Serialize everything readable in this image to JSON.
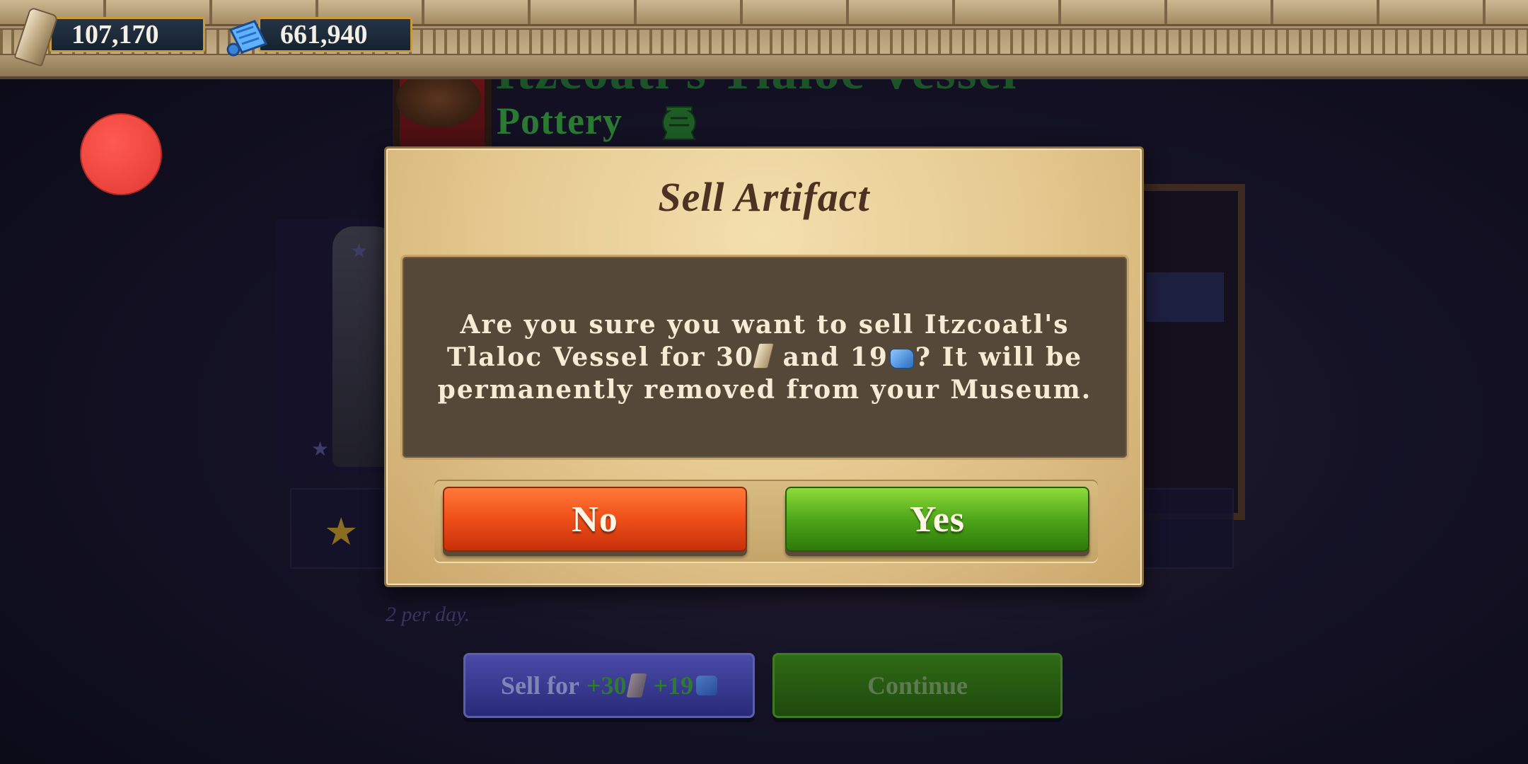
{
  "currency": {
    "artifacts": "107,170",
    "scrolls": "661,940"
  },
  "background": {
    "artifact_title": "Itzcoatl's Tlaloc Vessel",
    "category": "Pottery",
    "per_day_text": "2 per day.",
    "sell_button": {
      "label": "Sell for",
      "artifact_amount": "+30",
      "scroll_amount": "+19"
    },
    "continue_button": "Continue"
  },
  "dialog": {
    "title": "Sell Artifact",
    "message_part1": "Are you sure you want to sell Itzcoatl's Tlaloc Vessel for 30",
    "message_part2": " and 19",
    "message_part3": "? It will be permanently removed from your Museum.",
    "no_label": "No",
    "yes_label": "Yes"
  },
  "colors": {
    "no_button": "#f2521a",
    "yes_button": "#4ea61a",
    "dialog_bg": "#e3c68c",
    "message_box": "#564838",
    "record_indicator": "#e23a34"
  },
  "icons": [
    "artifact-icon",
    "scroll-icon",
    "vase-icon",
    "star-icon"
  ]
}
